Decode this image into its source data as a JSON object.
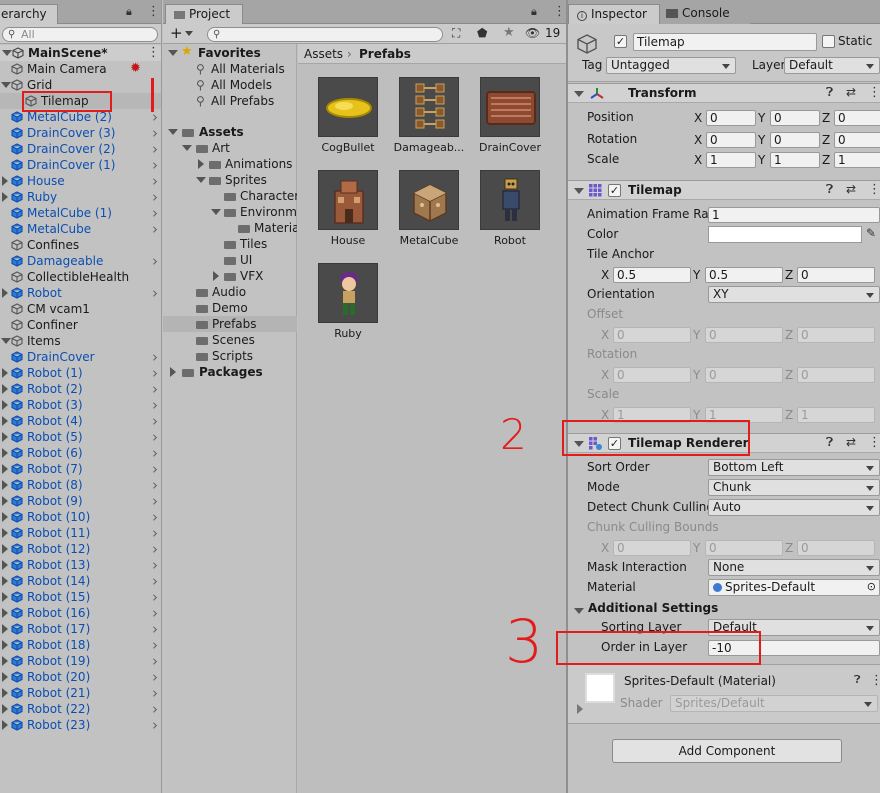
{
  "hierarchy": {
    "tab_label": "erarchy",
    "search_placeholder": "All",
    "scene": "MainScene*",
    "items": [
      {
        "label": "Main Camera",
        "blue": false
      },
      {
        "label": "Grid",
        "blue": false
      },
      {
        "label": "Tilemap",
        "blue": false
      },
      {
        "label": "MetalCube (2)",
        "blue": true
      },
      {
        "label": "DrainCover (3)",
        "blue": true
      },
      {
        "label": "DrainCover (2)",
        "blue": true
      },
      {
        "label": "DrainCover (1)",
        "blue": true
      },
      {
        "label": "House",
        "blue": true
      },
      {
        "label": "Ruby",
        "blue": true
      },
      {
        "label": "MetalCube (1)",
        "blue": true
      },
      {
        "label": "MetalCube",
        "blue": true
      },
      {
        "label": "Confines",
        "blue": false
      },
      {
        "label": "Damageable",
        "blue": true
      },
      {
        "label": "CollectibleHealth",
        "blue": false
      },
      {
        "label": "Robot",
        "blue": true
      },
      {
        "label": "CM vcam1",
        "blue": false
      },
      {
        "label": "Confiner",
        "blue": false
      },
      {
        "label": "Items",
        "blue": false
      },
      {
        "label": "DrainCover",
        "blue": true
      },
      {
        "label": "Robot (1)",
        "blue": true
      },
      {
        "label": "Robot (2)",
        "blue": true
      },
      {
        "label": "Robot (3)",
        "blue": true
      },
      {
        "label": "Robot (4)",
        "blue": true
      },
      {
        "label": "Robot (5)",
        "blue": true
      },
      {
        "label": "Robot (6)",
        "blue": true
      },
      {
        "label": "Robot (7)",
        "blue": true
      },
      {
        "label": "Robot (8)",
        "blue": true
      },
      {
        "label": "Robot (9)",
        "blue": true
      },
      {
        "label": "Robot (10)",
        "blue": true
      },
      {
        "label": "Robot (11)",
        "blue": true
      },
      {
        "label": "Robot (12)",
        "blue": true
      },
      {
        "label": "Robot (13)",
        "blue": true
      },
      {
        "label": "Robot (14)",
        "blue": true
      },
      {
        "label": "Robot (15)",
        "blue": true
      },
      {
        "label": "Robot (16)",
        "blue": true
      },
      {
        "label": "Robot (17)",
        "blue": true
      },
      {
        "label": "Robot (18)",
        "blue": true
      },
      {
        "label": "Robot (19)",
        "blue": true
      },
      {
        "label": "Robot (20)",
        "blue": true
      },
      {
        "label": "Robot (21)",
        "blue": true
      },
      {
        "label": "Robot (22)",
        "blue": true
      },
      {
        "label": "Robot (23)",
        "blue": true
      }
    ]
  },
  "project": {
    "tab_label": "Project",
    "add_label": "+",
    "hidden_count": "19",
    "tree": {
      "favorites": "Favorites",
      "all_materials": "All Materials",
      "all_models": "All Models",
      "all_prefabs": "All Prefabs",
      "assets": "Assets",
      "art": "Art",
      "animations": "Animations",
      "sprites": "Sprites",
      "characters": "Characters",
      "environment": "Environment",
      "materials": "Materials",
      "tiles": "Tiles",
      "ui": "UI",
      "vfx": "VFX",
      "audio": "Audio",
      "demo": "Demo",
      "prefabs": "Prefabs",
      "scenes": "Scenes",
      "scripts": "Scripts",
      "packages": "Packages"
    },
    "breadcrumb": {
      "root": "Assets",
      "sep": "›",
      "current": "Prefabs"
    },
    "prefabs": [
      "CogBullet",
      "Damageab...",
      "DrainCover",
      "House",
      "MetalCube",
      "Robot",
      "Ruby"
    ]
  },
  "inspector": {
    "tab_label": "Inspector",
    "console_tab": "Console",
    "object_name": "Tilemap",
    "static_label": "Static",
    "tag_label": "Tag",
    "tag_value": "Untagged",
    "layer_label": "Layer",
    "layer_value": "Default",
    "transform": {
      "title": "Transform",
      "position_label": "Position",
      "rotation_label": "Rotation",
      "scale_label": "Scale",
      "axis_x": "X",
      "axis_y": "Y",
      "axis_z": "Z",
      "position": [
        "0",
        "0",
        "0"
      ],
      "rotation": [
        "0",
        "0",
        "0"
      ],
      "scale": [
        "1",
        "1",
        "1"
      ]
    },
    "tilemap": {
      "title": "Tilemap",
      "frame_rate_label": "Animation Frame Rat",
      "frame_rate": "1",
      "color_label": "Color",
      "tile_anchor_label": "Tile Anchor",
      "tile_anchor": [
        "0.5",
        "0.5",
        "0"
      ],
      "orientation_label": "Orientation",
      "orientation": "XY",
      "offset_label": "Offset",
      "offset": [
        "0",
        "0",
        "0"
      ],
      "rotation_label": "Rotation",
      "rotation": [
        "0",
        "0",
        "0"
      ],
      "scale_label": "Scale",
      "scale": [
        "1",
        "1",
        "1"
      ]
    },
    "renderer": {
      "title": "Tilemap Renderer",
      "sort_order_label": "Sort Order",
      "sort_order": "Bottom Left",
      "mode_label": "Mode",
      "mode": "Chunk",
      "culling_label": "Detect Chunk Culling",
      "culling": "Auto",
      "bounds_label": "Chunk Culling Bounds",
      "bounds": [
        "0",
        "0",
        "0"
      ],
      "mask_label": "Mask Interaction",
      "mask": "None",
      "material_label": "Material",
      "material": "Sprites-Default",
      "additional": "Additional Settings",
      "sorting_layer_label": "Sorting Layer",
      "sorting_layer": "Default",
      "order_label": "Order in Layer",
      "order": "-10"
    },
    "material_preview": {
      "name": "Sprites-Default (Material)",
      "shader_label": "Shader",
      "shader": "Sprites/Default"
    },
    "add_component": "Add Component"
  },
  "annotations": {
    "step2": "2",
    "step3": "3"
  },
  "colors": {
    "highlight": "#e21b1b",
    "prefab_blue": "#0b4fb0"
  }
}
